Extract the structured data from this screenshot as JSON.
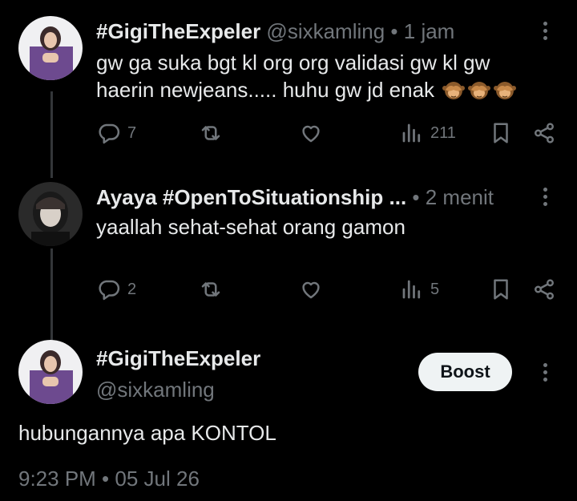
{
  "posts": [
    {
      "display_name": "#GigiTheExpeler",
      "handle": "@sixkamling",
      "separator": "•",
      "time": "1 jam",
      "text_line1": "gw ga suka bgt kl org org validasi gw kl gw",
      "text_line2": "haerin newjeans..... huhu gw jd enak",
      "emoji": "see-no-evil-monkey",
      "emoji_count": 3,
      "replies": "7",
      "views": "211"
    },
    {
      "display_name": "Ayaya #OpenToSituationship ...",
      "separator": "•",
      "time": "2 menit",
      "text": "yaallah sehat-sehat orang gamon",
      "replies": "2",
      "views": "5"
    }
  ],
  "main": {
    "display_name": "#GigiTheExpeler",
    "handle": "@sixkamling",
    "boost_label": "Boost",
    "text": "hubungannya apa KONTOL",
    "timestamp": "9:23 PM • 05 Jul 26"
  },
  "icons": [
    "reply-icon",
    "repost-icon",
    "like-icon",
    "views-icon",
    "bookmark-icon",
    "share-icon",
    "more-icon"
  ],
  "colors": {
    "background": "#000000",
    "text": "#e7e9ea",
    "muted": "#71767b",
    "boost_bg": "#eff3f4"
  }
}
